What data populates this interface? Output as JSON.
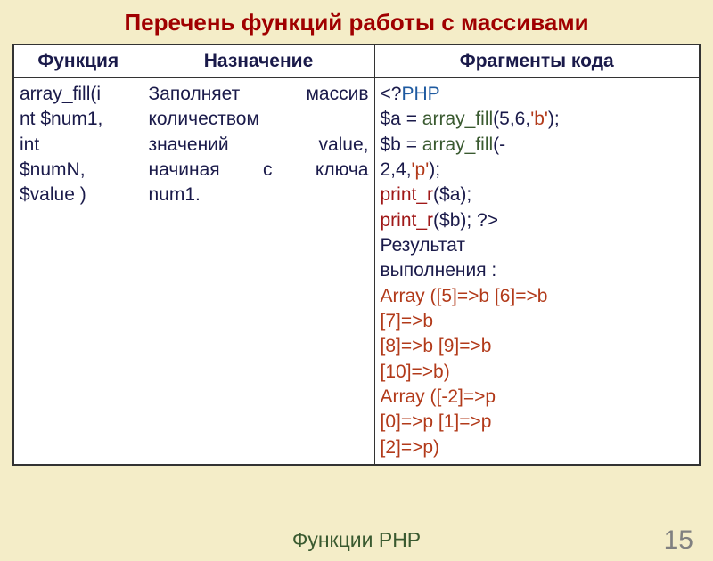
{
  "title": "Перечень функций работы с массивами",
  "headers": {
    "c1": "Функция",
    "c2": "Назначение",
    "c3": "Фрагменты кода"
  },
  "row": {
    "func": {
      "l1": "array_fill(i",
      "l2": "nt $num1,",
      "l3": "int",
      "l4": "$numN,",
      "l5": "$value )"
    },
    "desc": {
      "l1a": "Заполняет",
      "l1b": "массив",
      "l2a": "количеством",
      "l3a": "значений",
      "l3b": "value,",
      "l4a": "начиная",
      "l4b": "с",
      "l4c": "ключа",
      "l5a": "num1."
    },
    "code": {
      "open": "<?",
      "php": "PHP",
      "l2a": "$a = ",
      "l2b": "array_fill",
      "l2c": "(5,6,",
      "l2d": "'b'",
      "l2e": ");",
      "l3a": "$b = ",
      "l3b": "array_fill",
      "l3c": "(-",
      "l4a": "2,4,",
      "l4b": "'p'",
      "l4c": ");",
      "l5a": "print_r",
      "l5b": "($a);",
      "l6a": "print_r",
      "l6b": "($b); ?>",
      "res1": "Результат",
      "res2": "выполнения :",
      "o1": "Array ([5]=>b [6]=>b",
      "o2": "[7]=>b",
      "o3": "[8]=>b [9]=>b",
      "o4": "[10]=>b)",
      "o5": "Array ([-2]=>p",
      "o6": "[0]=>p [1]=>p",
      "o7": "[2]=>p)"
    }
  },
  "footer": {
    "label": "Функции PHP",
    "page": "15"
  }
}
